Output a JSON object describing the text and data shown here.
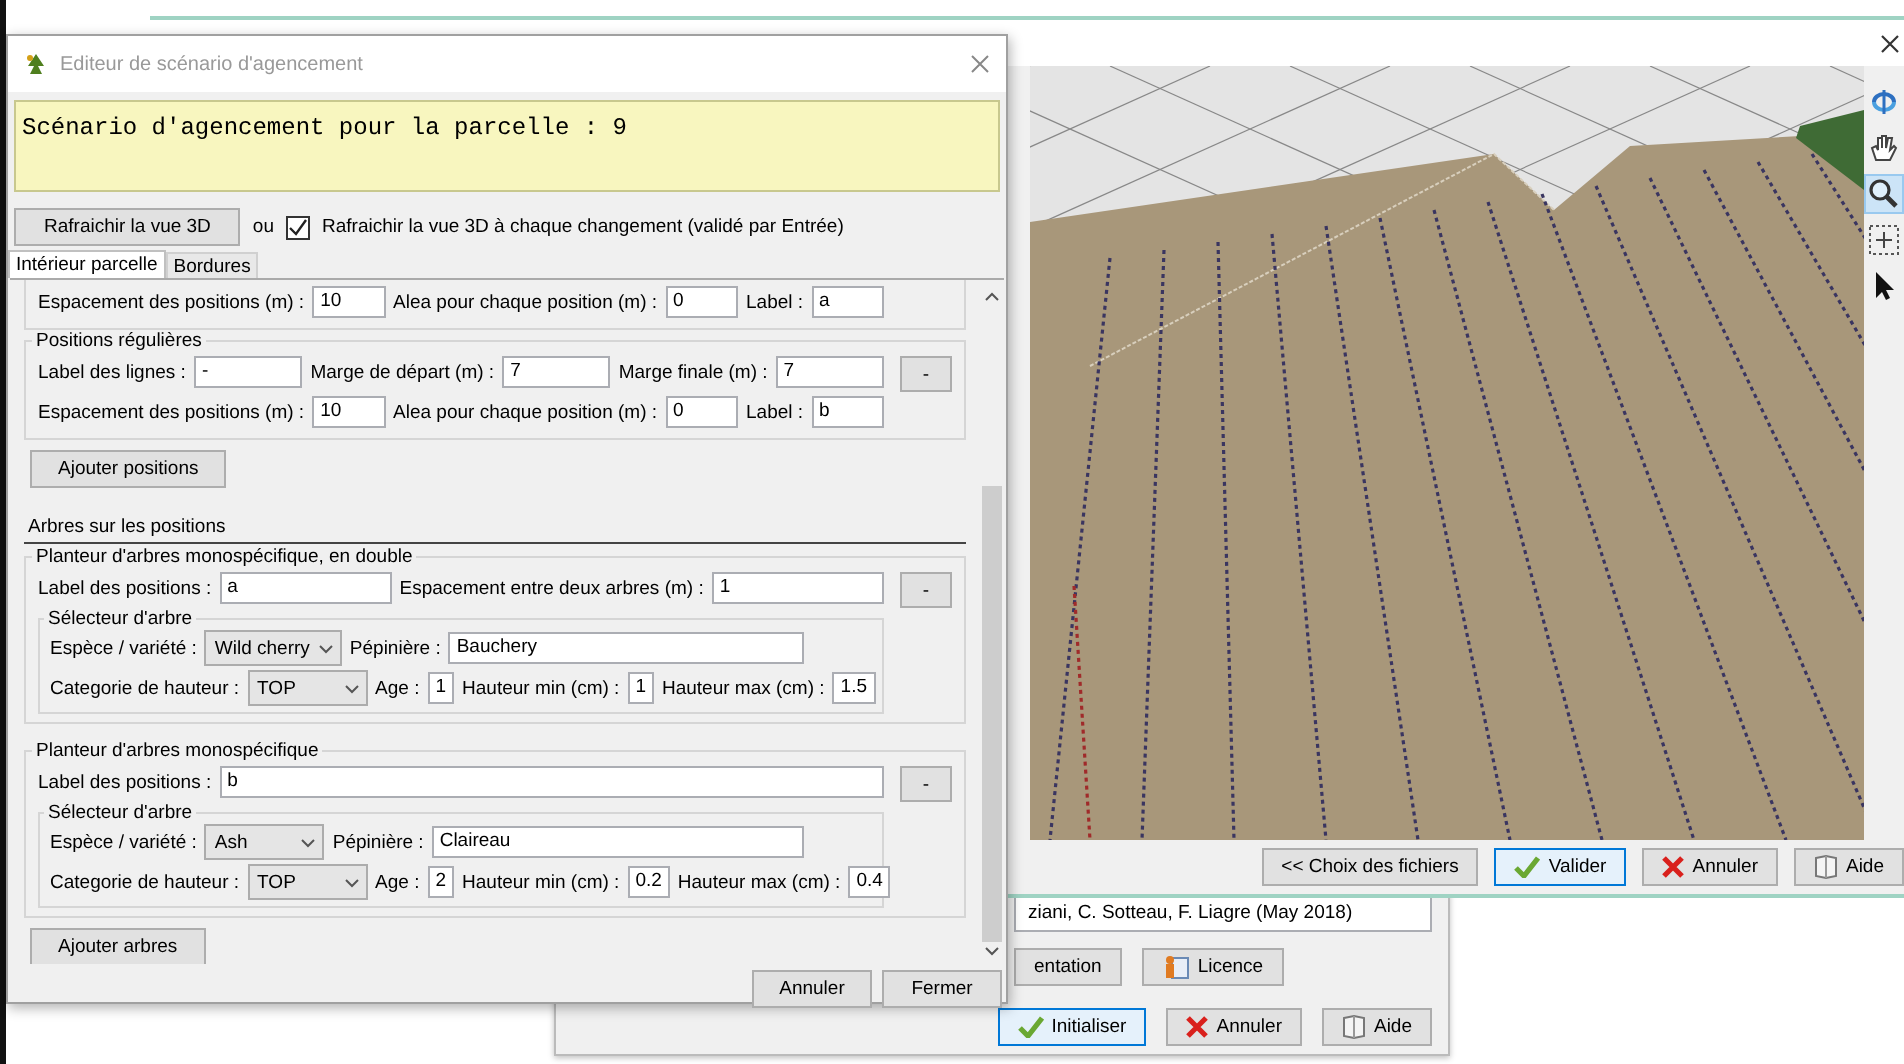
{
  "dialog": {
    "title": "Editeur de scénario d'agencement",
    "scenario_text": "Scénario d'agencement pour la parcelle : 9",
    "refresh_button": "Rafraichir la vue 3D",
    "separator": "ou",
    "auto_refresh": {
      "label": "Rafraichir la vue 3D à chaque changement (validé par Entrée)",
      "checked": true
    },
    "tabs": [
      {
        "label": "Intérieur parcelle",
        "selected": true
      },
      {
        "label": "Bordures",
        "selected": false
      }
    ],
    "position_groups": [
      {
        "rows": [
          {
            "fields": [
              {
                "label": "Espacement des positions (m) :",
                "kind": "field",
                "value": "10"
              },
              {
                "label": "Alea pour chaque position (m) :",
                "kind": "field",
                "value": "0"
              },
              {
                "label": "Label :",
                "kind": "field",
                "value": "a"
              }
            ]
          }
        ]
      },
      {
        "title": "Positions régulières",
        "remove_button": "-",
        "rows": [
          {
            "fields": [
              {
                "label": "Label des lignes :",
                "kind": "field",
                "value": "-"
              },
              {
                "label": "Marge de départ (m) :",
                "kind": "field",
                "value": "7"
              },
              {
                "label": "Marge finale (m) :",
                "kind": "field",
                "value": "7"
              }
            ]
          },
          {
            "fields": [
              {
                "label": "Espacement des positions (m) :",
                "kind": "field",
                "value": "10"
              },
              {
                "label": "Alea pour chaque position (m) :",
                "kind": "field",
                "value": "0"
              },
              {
                "label": "Label :",
                "kind": "field",
                "value": "b"
              }
            ]
          }
        ]
      }
    ],
    "add_positions_button": "Ajouter positions",
    "trees_section_title": "Arbres sur les positions",
    "planters": [
      {
        "title": "Planteur d'arbres monospécifique, en double",
        "remove_button": "-",
        "rows": [
          {
            "fields": [
              {
                "label": "Label des positions :",
                "kind": "field",
                "value": "a"
              },
              {
                "label": "Espacement entre deux arbres (m) :",
                "kind": "field",
                "value": "1"
              }
            ]
          }
        ],
        "selector": {
          "title": "Sélecteur d'arbre",
          "rows": [
            {
              "fields": [
                {
                  "label": "Espèce / variété :",
                  "kind": "combo",
                  "value": "Wild cherry"
                },
                {
                  "label": "Pépinière :",
                  "kind": "field",
                  "value": "Bauchery"
                }
              ]
            },
            {
              "fields": [
                {
                  "label": "Categorie de hauteur :",
                  "kind": "wide_combo",
                  "value": "TOP"
                },
                {
                  "label": "Age :",
                  "kind": "short_field",
                  "value": "1"
                },
                {
                  "label": "Hauteur min (cm) :",
                  "kind": "short_field",
                  "value": "1"
                },
                {
                  "label": "Hauteur max (cm) :",
                  "kind": "short_field",
                  "value": "1.5"
                }
              ]
            }
          ]
        }
      },
      {
        "title": "Planteur d'arbres monospécifique",
        "remove_button": "-",
        "rows": [
          {
            "fields": [
              {
                "label": "Label des positions :",
                "kind": "field",
                "value": "b"
              }
            ]
          }
        ],
        "selector": {
          "title": "Sélecteur d'arbre",
          "rows": [
            {
              "fields": [
                {
                  "label": "Espèce / variété :",
                  "kind": "combo",
                  "value": "Ash"
                },
                {
                  "label": "Pépinière :",
                  "kind": "field",
                  "value": "Claireau"
                }
              ]
            },
            {
              "fields": [
                {
                  "label": "Categorie de hauteur :",
                  "kind": "wide_combo",
                  "value": "TOP"
                },
                {
                  "label": "Age :",
                  "kind": "short_field",
                  "value": "2"
                },
                {
                  "label": "Hauteur min (cm) :",
                  "kind": "short_field",
                  "value": "0.2"
                },
                {
                  "label": "Hauteur max (cm) :",
                  "kind": "short_field",
                  "value": "0.4"
                }
              ]
            }
          ]
        }
      }
    ],
    "add_trees_button": "Ajouter arbres",
    "footer_buttons": [
      {
        "label": "Annuler",
        "default": false
      },
      {
        "label": "Fermer",
        "default": false
      }
    ]
  },
  "view_window": {
    "tools": [
      {
        "kind": "rotate",
        "selected": false
      },
      {
        "kind": "pan",
        "selected": false
      },
      {
        "kind": "zoom",
        "selected": true
      },
      {
        "kind": "fit",
        "selected": false
      },
      {
        "kind": "pointer",
        "selected": false
      }
    ],
    "buttons": [
      {
        "kind": "plain",
        "label": "<< Choix des fichiers",
        "default": false
      },
      {
        "kind": "confirm",
        "label": "Valider",
        "default": true
      },
      {
        "kind": "cancel",
        "label": "Annuler",
        "default": false
      },
      {
        "kind": "help",
        "label": "Aide",
        "default": false
      }
    ]
  },
  "back_window": {
    "credits": "ziani, C. Sotteau, F. Liagre (May 2018)",
    "buttons": [
      {
        "kind": "plain",
        "label": "entation",
        "default": false
      },
      {
        "kind": "licence",
        "label": "Licence",
        "default": false
      }
    ],
    "footer_buttons": [
      {
        "kind": "confirm",
        "label": "Initialiser",
        "default": true
      },
      {
        "kind": "cancel",
        "label": "Annuler",
        "default": false
      },
      {
        "kind": "help",
        "label": "Aide",
        "default": false
      }
    ]
  }
}
